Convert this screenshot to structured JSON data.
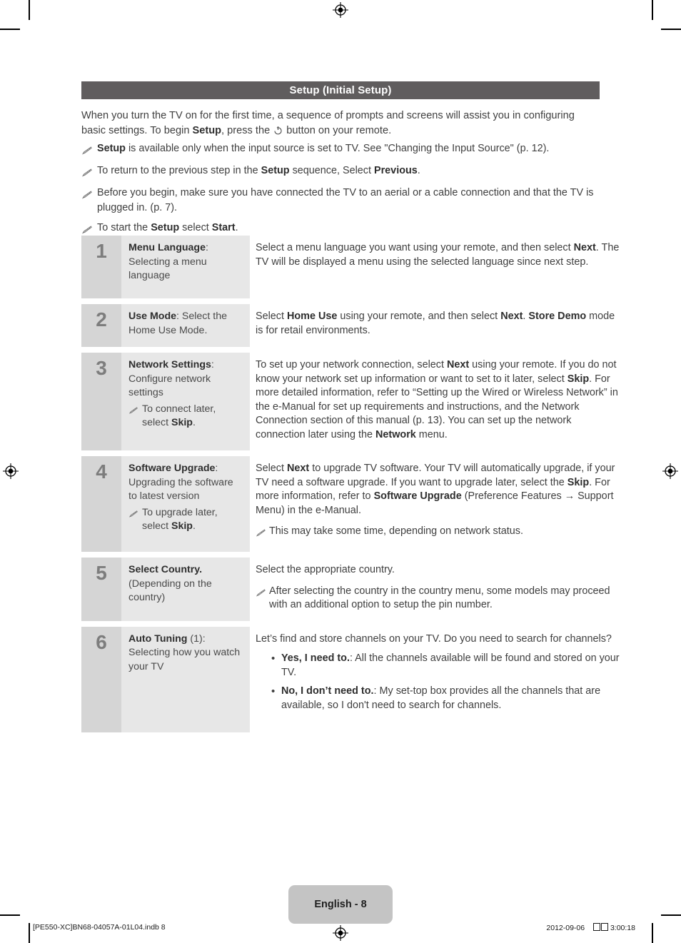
{
  "section": {
    "title": "Setup (Initial Setup)"
  },
  "intro": {
    "part1": "When you turn the TV on for the first time, a sequence of prompts and screens will assist you in configuring basic settings. To begin ",
    "bold1": "Setup",
    "part2": ", press the ",
    "power_icon": "power-icon",
    "part3": " button on your remote."
  },
  "notes": [
    {
      "icon": "pencil-note-icon",
      "segments": [
        {
          "text": "Setup",
          "bold": true
        },
        {
          "text": " is available only when the input source is set to TV. See \"Changing the Input Source\" (p. 12).",
          "bold": false
        }
      ]
    },
    {
      "icon": "pencil-note-icon",
      "segments": [
        {
          "text": "To return to the previous step in the ",
          "bold": false
        },
        {
          "text": "Setup",
          "bold": true
        },
        {
          "text": " sequence, Select ",
          "bold": false
        },
        {
          "text": "Previous",
          "bold": true
        },
        {
          "text": ".",
          "bold": false
        }
      ]
    },
    {
      "icon": "pencil-note-icon",
      "segments": [
        {
          "text": "Before you begin, make sure you have connected the TV to an aerial or a cable connection and that the TV is plugged in. (p. 7).",
          "bold": false
        }
      ]
    },
    {
      "icon": "pencil-note-icon",
      "segments": [
        {
          "text": "To start the ",
          "bold": false
        },
        {
          "text": "Setup",
          "bold": true
        },
        {
          "text": " select ",
          "bold": false
        },
        {
          "text": "Start",
          "bold": true
        },
        {
          "text": ".",
          "bold": false
        }
      ]
    }
  ],
  "steps": [
    {
      "number": "1",
      "label_segments": [
        {
          "text": "Menu Language",
          "bold": true
        },
        {
          "text": ":",
          "bold": false
        },
        {
          "text": "\nSelecting a menu language",
          "bold": false
        }
      ],
      "label_subnote": null,
      "desc_segments": [
        {
          "text": "Select a menu language you want using your remote, and then select ",
          "bold": false
        },
        {
          "text": "Next",
          "bold": true
        },
        {
          "text": ". The TV will be displayed a menu using the selected language since next step.",
          "bold": false
        }
      ],
      "desc_subnote": null,
      "desc_bullets": [],
      "min_height": 88
    },
    {
      "number": "2",
      "label_segments": [
        {
          "text": "Use Mode",
          "bold": true
        },
        {
          "text": ": Select the Home Use Mode.",
          "bold": false
        }
      ],
      "label_subnote": null,
      "desc_segments": [
        {
          "text": "Select ",
          "bold": false
        },
        {
          "text": "Home Use",
          "bold": true
        },
        {
          "text": " using your remote, and then select ",
          "bold": false
        },
        {
          "text": "Next",
          "bold": true
        },
        {
          "text": ". ",
          "bold": false
        },
        {
          "text": "Store Demo",
          "bold": true
        },
        {
          "text": " mode is for retail environments.",
          "bold": false
        }
      ],
      "desc_subnote": null,
      "desc_bullets": [],
      "min_height": 60
    },
    {
      "number": "3",
      "label_segments": [
        {
          "text": "Network Settings",
          "bold": true
        },
        {
          "text": ":",
          "bold": false
        },
        {
          "text": "\nConfigure network settings",
          "bold": false
        }
      ],
      "label_subnote": [
        {
          "text": "To connect later, select ",
          "bold": false
        },
        {
          "text": "Skip",
          "bold": true
        },
        {
          "text": ".",
          "bold": false
        }
      ],
      "desc_segments": [
        {
          "text": "To set up your network connection, select ",
          "bold": false
        },
        {
          "text": "Next",
          "bold": true
        },
        {
          "text": " using your remote. If you do not know your network set up information or want to set to it later, select ",
          "bold": false
        },
        {
          "text": "Skip",
          "bold": true
        },
        {
          "text": ". For more detailed information, refer to “Setting up the Wired or Wireless Network” in the e-Manual for set up requirements and instructions, and the Network Connection section of this manual (p. 13). You can set up the network connection later using the ",
          "bold": false
        },
        {
          "text": "Network",
          "bold": true
        },
        {
          "text": " menu.",
          "bold": false
        }
      ],
      "desc_subnote": null,
      "desc_bullets": [],
      "min_height": 128
    },
    {
      "number": "4",
      "label_segments": [
        {
          "text": "Software Upgrade",
          "bold": true
        },
        {
          "text": ":",
          "bold": false
        },
        {
          "text": "\nUpgrading the software to latest version",
          "bold": false
        }
      ],
      "label_subnote": [
        {
          "text": "To upgrade later, select ",
          "bold": false
        },
        {
          "text": "Skip",
          "bold": true
        },
        {
          "text": ".",
          "bold": false
        }
      ],
      "desc_segments": [
        {
          "text": "Select ",
          "bold": false
        },
        {
          "text": "Next",
          "bold": true
        },
        {
          "text": " to upgrade TV software. Your TV will automatically upgrade, if your TV need a software upgrade. If you want to upgrade later, select the ",
          "bold": false
        },
        {
          "text": "Skip",
          "bold": true
        },
        {
          "text": ". For more information, refer to ",
          "bold": false
        },
        {
          "text": "Software Upgrade",
          "bold": true
        },
        {
          "text": " (Preference Features → Support Menu) in the e-Manual.",
          "bold": false
        }
      ],
      "desc_subnote": [
        {
          "text": "This may take some time, depending on network status.",
          "bold": false
        }
      ],
      "desc_bullets": [],
      "min_height": 134
    },
    {
      "number": "5",
      "label_segments": [
        {
          "text": "Select Country.",
          "bold": true
        },
        {
          "text": "\n(Depending on the country)",
          "bold": false
        }
      ],
      "label_subnote": null,
      "desc_segments": [
        {
          "text": "Select the appropriate country.",
          "bold": false
        }
      ],
      "desc_subnote": [
        {
          "text": "After selecting the country in the country menu, some models may proceed with an additional option to setup the pin number.",
          "bold": false
        }
      ],
      "desc_bullets": [],
      "min_height": 80
    },
    {
      "number": "6",
      "label_segments": [
        {
          "text": "Auto Tuning",
          "bold": true
        },
        {
          "text": " (1):",
          "bold": false
        },
        {
          "text": "\nSelecting how you watch your TV",
          "bold": false
        }
      ],
      "label_subnote": null,
      "desc_segments": [
        {
          "text": "Let’s find and store channels on your TV. Do you need to search for channels?",
          "bold": false
        }
      ],
      "desc_subnote": null,
      "desc_bullets": [
        [
          {
            "text": "Yes, I need to.",
            "bold": true
          },
          {
            "text": ": All the channels available will be found and stored on your TV.",
            "bold": false
          }
        ],
        [
          {
            "text": "No, I don’t need to.",
            "bold": true
          },
          {
            "text": ": My set-top box provides all the channels that are available, so I don't need to search for channels.",
            "bold": false
          }
        ]
      ],
      "min_height": 148
    }
  ],
  "footer": {
    "page_label": "English - 8",
    "print_file": "[PE550-XC]BN68-04057A-01L04.indb   8",
    "print_date": "2012-09-06",
    "print_time": "3:00:18"
  },
  "colors": {
    "heading_bar": "#605d5e",
    "number_cell": "#d5d5d5",
    "label_cell": "#e7e7e7",
    "page_chip": "#c4c4c4",
    "body_text": "#3f3f3f"
  }
}
